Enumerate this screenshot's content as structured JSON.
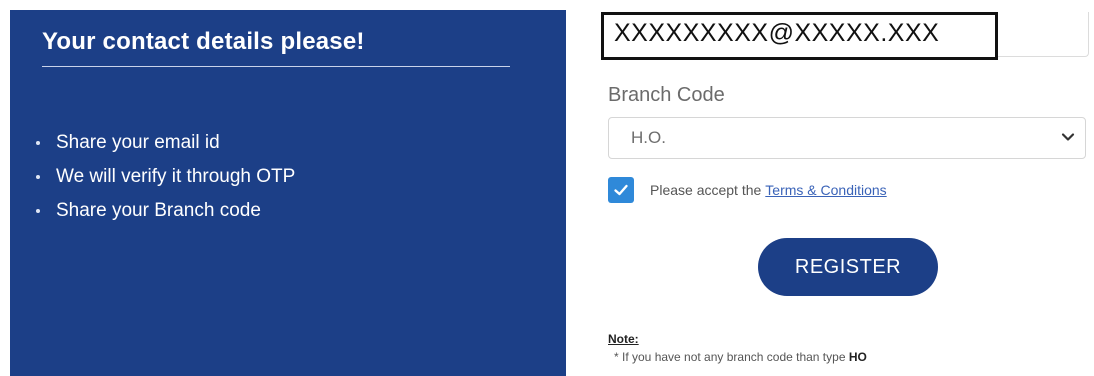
{
  "left_panel": {
    "title": "Your contact details please!",
    "bullets": [
      "Share your email id",
      "We will verify it through OTP",
      "Share your Branch code"
    ],
    "bg_color": "#1c3f87"
  },
  "form": {
    "email_value": "XXXXXXXXX@XXXXX.XXX",
    "branch_label": "Branch Code",
    "branch_selected": "H.O.",
    "terms_prefix": "Please accept the",
    "terms_link": "Terms & Conditions",
    "terms_checked": true,
    "register_label": "REGISTER",
    "note_label": "Note:",
    "note_text": "* If you have not any branch code than type",
    "note_bold": "HO"
  },
  "icons": {
    "chevron": "chevron-down-icon",
    "check": "checkmark-icon"
  },
  "colors": {
    "brand": "#1c3f87",
    "checkbox": "#2f89d9",
    "link": "#3a63b8"
  }
}
